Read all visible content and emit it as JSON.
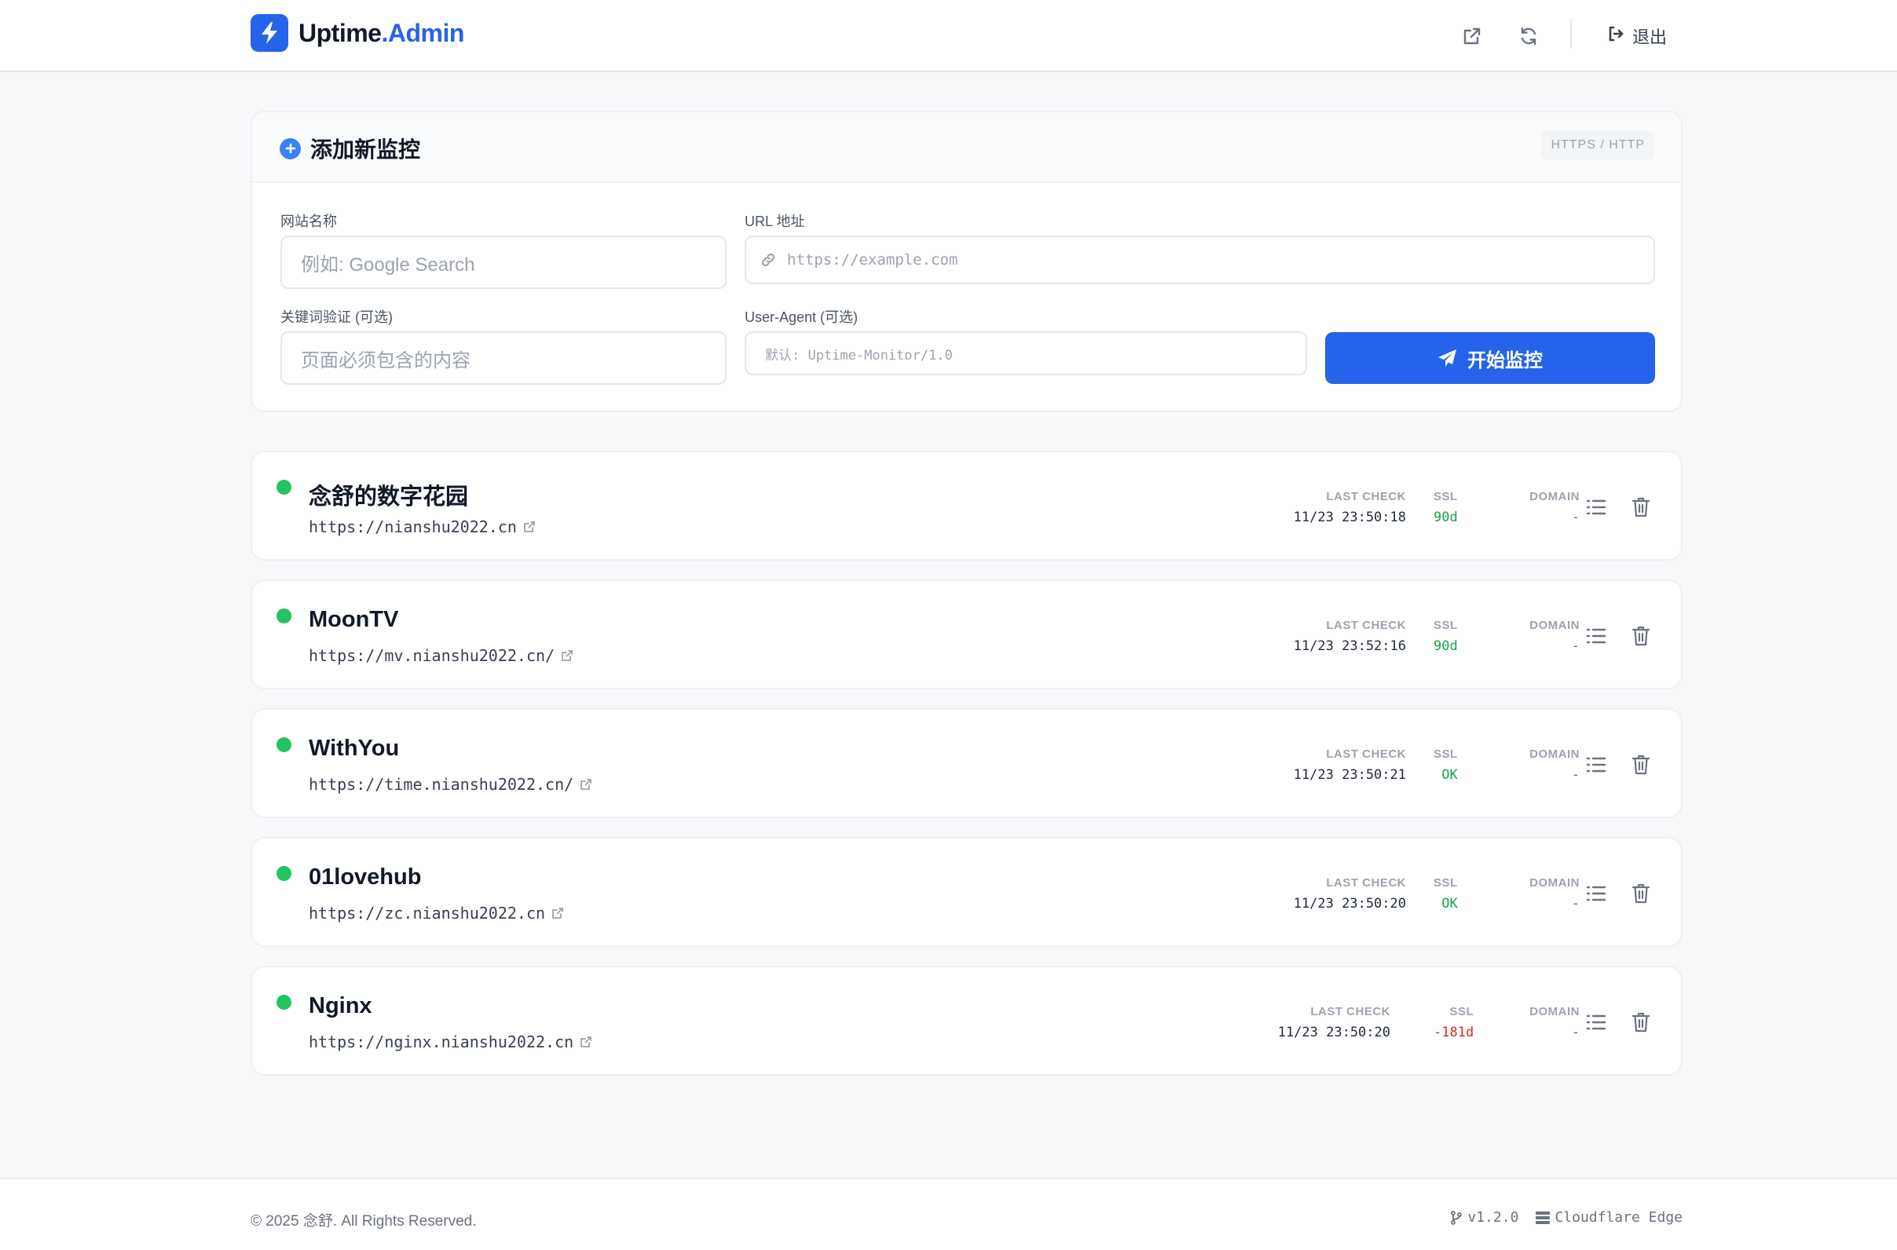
{
  "header": {
    "brand_part1": "Uptime",
    "brand_part2": ".Admin",
    "logout_label": "退出"
  },
  "add_form": {
    "title": "添加新监控",
    "protocol_badge": "HTTPS / HTTP",
    "name_label": "网站名称",
    "name_placeholder": "例如: Google Search",
    "url_label": "URL 地址",
    "url_placeholder": "https://example.com",
    "keyword_label": "关键词验证 (可选)",
    "keyword_placeholder": "页面必须包含的内容",
    "ua_label": "User-Agent (可选)",
    "ua_placeholder": "默认: Uptime-Monitor/1.0",
    "submit_label": "开始监控"
  },
  "stat_headers": {
    "last_check": "LAST CHECK",
    "ssl": "SSL",
    "domain": "DOMAIN"
  },
  "monitors": [
    {
      "name": "念舒的数字花园",
      "url": "https://nianshu2022.cn",
      "last_check": "11/23 23:50:18",
      "ssl": "90d",
      "ssl_status": "ok",
      "domain": "-"
    },
    {
      "name": "MoonTV",
      "url": "https://mv.nianshu2022.cn/",
      "last_check": "11/23 23:52:16",
      "ssl": "90d",
      "ssl_status": "ok",
      "domain": "-"
    },
    {
      "name": "WithYou",
      "url": "https://time.nianshu2022.cn/",
      "last_check": "11/23 23:50:21",
      "ssl": "OK",
      "ssl_status": "ok",
      "domain": "-"
    },
    {
      "name": "01lovehub",
      "url": "https://zc.nianshu2022.cn",
      "last_check": "11/23 23:50:20",
      "ssl": "OK",
      "ssl_status": "ok",
      "domain": "-"
    },
    {
      "name": "Nginx",
      "url": "https://nginx.nianshu2022.cn",
      "last_check": "11/23 23:50:20",
      "ssl": "-181d",
      "ssl_status": "bad",
      "domain": "-"
    }
  ],
  "footer": {
    "copyright": "© 2025 念舒. All Rights Reserved.",
    "version": "v1.2.0",
    "platform": "Cloudflare Edge"
  },
  "colors": {
    "accent": "#2563eb",
    "status_up": "#22c55e",
    "ssl_ok": "#16a34a",
    "ssl_bad": "#dc2626"
  }
}
